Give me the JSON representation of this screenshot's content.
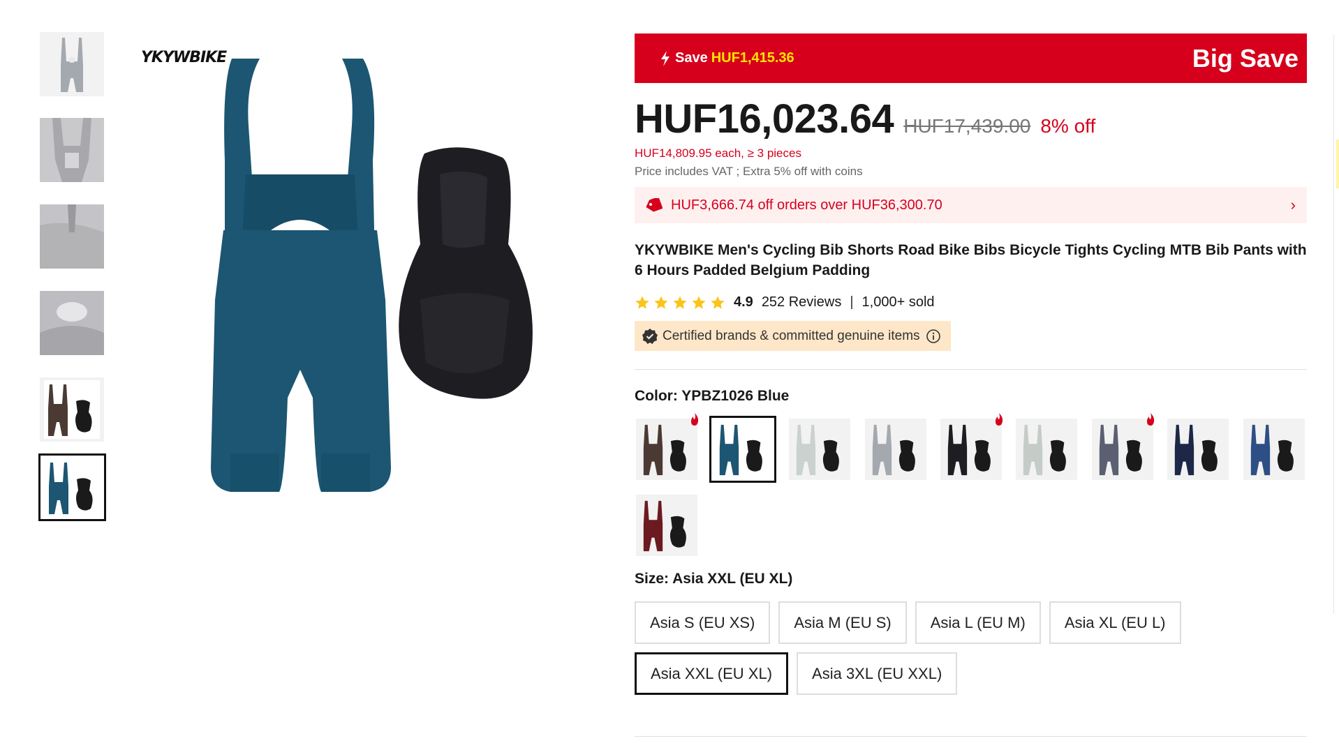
{
  "brand_logo": "YKYWBIKE",
  "promo": {
    "save_label": "Save",
    "save_value": "HUF1,415.36",
    "big_save": "Big Save"
  },
  "price": {
    "current": "HUF16,023.64",
    "original": "HUF17,439.00",
    "discount": "8% off",
    "bulk": "HUF14,809.95 each, ≥ 3 pieces",
    "vat_note": "Price includes VAT ; Extra 5% off with coins"
  },
  "coupon": {
    "text": "HUF3,666.74 off orders over HUF36,300.70",
    "chevron": "›"
  },
  "product_title": "YKYWBIKE Men's Cycling Bib Shorts Road Bike Bibs Bicycle Tights Cycling MTB Bib Pants with 6 Hours Padded Belgium Padding",
  "rating": {
    "stars": 5,
    "score": "4.9",
    "reviews": "252 Reviews",
    "separator": "|",
    "sold": "1,000+ sold"
  },
  "certified": "Certified brands & committed genuine items",
  "color": {
    "label": "Color: YPBZ1026 Blue",
    "options": [
      {
        "name": "brown",
        "hex": "#4a3a33",
        "hot": true
      },
      {
        "name": "teal-blue",
        "hex": "#1c5672",
        "hot": false,
        "selected": true
      },
      {
        "name": "light-grey",
        "hex": "#c9d2cf",
        "hot": false
      },
      {
        "name": "grey",
        "hex": "#a4a9b0",
        "hot": false
      },
      {
        "name": "black",
        "hex": "#1d1d22",
        "hot": true
      },
      {
        "name": "pale-grey",
        "hex": "#c5ccc8",
        "hot": false
      },
      {
        "name": "slate",
        "hex": "#5a6072",
        "hot": true
      },
      {
        "name": "navy",
        "hex": "#1d2747",
        "hot": false
      },
      {
        "name": "royal-blue",
        "hex": "#2d4f86",
        "hot": false
      },
      {
        "name": "maroon",
        "hex": "#6b1a20",
        "hot": false
      }
    ]
  },
  "size": {
    "label": "Size: Asia XXL (EU XL)",
    "options": [
      "Asia S (EU XS)",
      "Asia M (EU S)",
      "Asia L (EU M)",
      "Asia XL (EU L)",
      "Asia XXL (EU XL)",
      "Asia 3XL (EU XXL)"
    ],
    "selected_index": 4
  },
  "colors": {
    "accent_red": "#d6001c",
    "coupon_bg": "#fff0f0",
    "certified_bg": "#fde7c8",
    "star": "#fcc419",
    "save_yellow": "#ffe400",
    "main_product": "#1c5672"
  },
  "thumbnails": [
    {
      "name": "grey-bib-front",
      "hex": "#a4a9b0"
    },
    {
      "name": "grey-detail-1",
      "hex": "#a8a8ac"
    },
    {
      "name": "grey-detail-2",
      "hex": "#b3b3b6"
    },
    {
      "name": "grey-detail-3",
      "hex": "#b0b0b3"
    },
    {
      "name": "brown-bib",
      "hex": "#4a3a33"
    },
    {
      "name": "teal-bib",
      "hex": "#1c5672",
      "selected": true
    }
  ]
}
